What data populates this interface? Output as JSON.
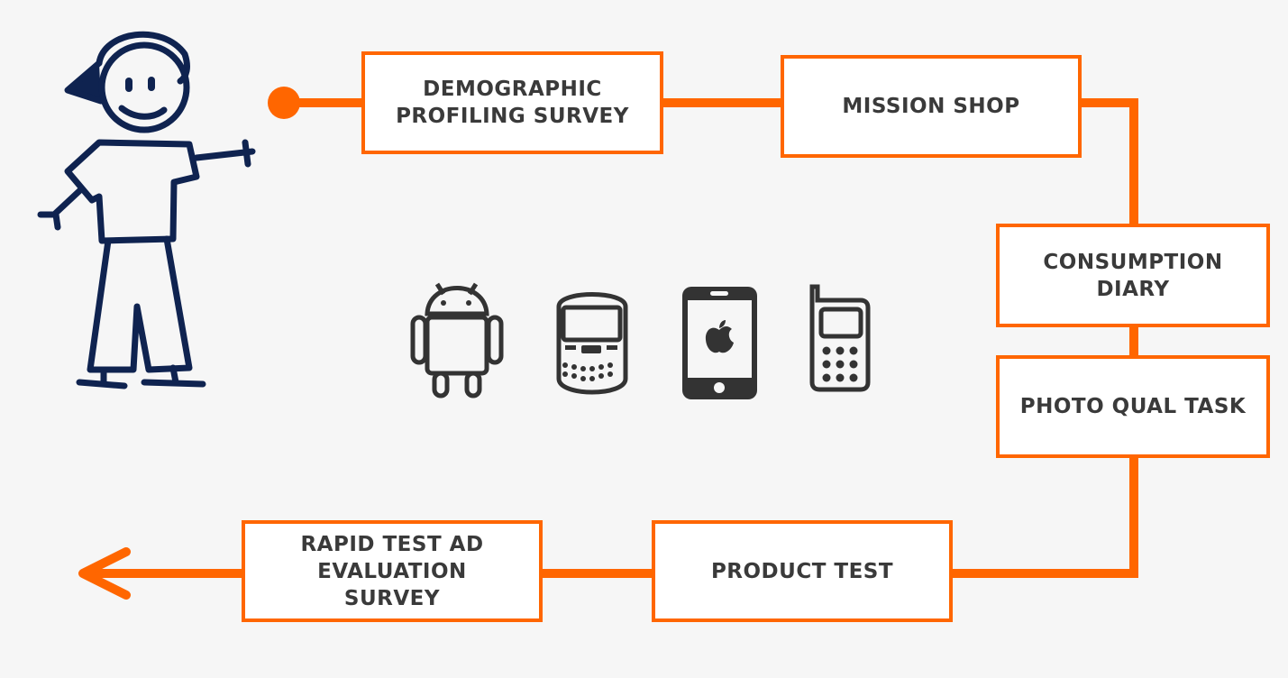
{
  "colors": {
    "accent": "#ff6600",
    "figure": "#0f2350",
    "icon": "#333333",
    "text": "#3a3a3a",
    "background": "#f6f6f6"
  },
  "steps": [
    {
      "label": "DEMOGRAPHIC\nPROFILING SURVEY"
    },
    {
      "label": "MISSION SHOP"
    },
    {
      "label": "CONSUMPTION\nDIARY"
    },
    {
      "label": "PHOTO QUAL TASK"
    },
    {
      "label": "PRODUCT TEST"
    },
    {
      "label": "RAPID TEST AD\nEVALUATION\nSURVEY"
    }
  ],
  "icons": [
    "stick-figure-icon",
    "android-icon",
    "blackberry-icon",
    "iphone-icon",
    "feature-phone-icon",
    "arrow-left-icon"
  ]
}
